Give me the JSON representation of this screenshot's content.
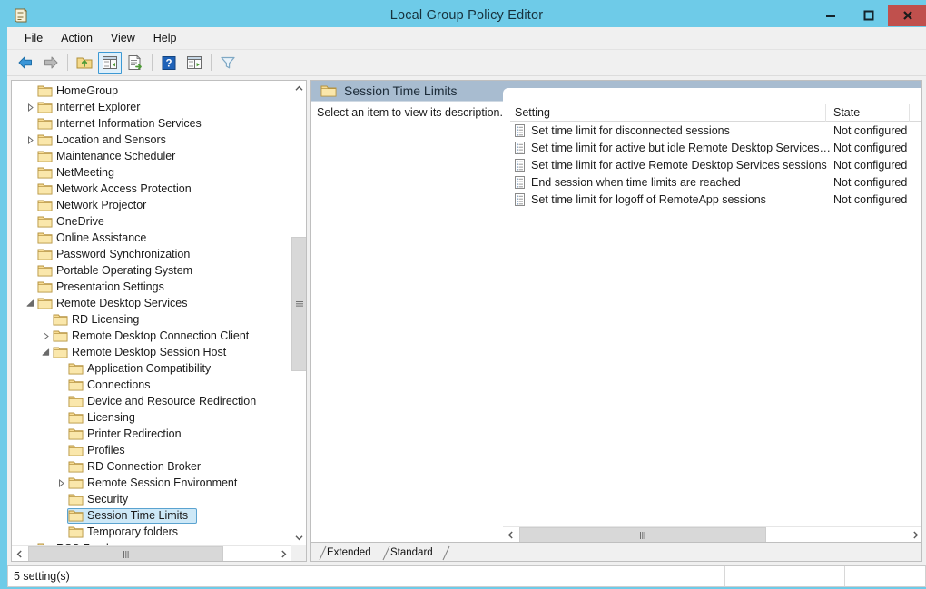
{
  "window": {
    "title": "Local Group Policy Editor",
    "icon": "console-scroll-icon",
    "accent_color": "#6ecbe8",
    "close_button_color": "#c0504d",
    "buttons": {
      "minimize": "minimize",
      "maximize": "maximize",
      "close": "close"
    }
  },
  "menubar": {
    "items": [
      {
        "label": "File"
      },
      {
        "label": "Action"
      },
      {
        "label": "View"
      },
      {
        "label": "Help"
      }
    ]
  },
  "toolbar": {
    "buttons": [
      {
        "name": "back-arrow-icon",
        "tooltip": "Back"
      },
      {
        "name": "forward-arrow-icon",
        "tooltip": "Forward"
      },
      {
        "name": "up-one-level-folder-icon",
        "tooltip": "Up One Level"
      },
      {
        "name": "show-hide-console-tree-icon",
        "tooltip": "Show/Hide Console Tree",
        "selected": true
      },
      {
        "name": "export-list-icon",
        "tooltip": "Export List"
      },
      {
        "name": "help-icon",
        "tooltip": "Help"
      },
      {
        "name": "properties-icon",
        "tooltip": "Properties"
      },
      {
        "name": "filter-icon",
        "tooltip": "Filter"
      }
    ]
  },
  "tree": {
    "nodes": [
      {
        "label": "HomeGroup",
        "indent": 2,
        "twist": "none"
      },
      {
        "label": "Internet Explorer",
        "indent": 2,
        "twist": "collapsed"
      },
      {
        "label": "Internet Information Services",
        "indent": 2,
        "twist": "none"
      },
      {
        "label": "Location and Sensors",
        "indent": 2,
        "twist": "collapsed"
      },
      {
        "label": "Maintenance Scheduler",
        "indent": 2,
        "twist": "none"
      },
      {
        "label": "NetMeeting",
        "indent": 2,
        "twist": "none"
      },
      {
        "label": "Network Access Protection",
        "indent": 2,
        "twist": "none"
      },
      {
        "label": "Network Projector",
        "indent": 2,
        "twist": "none"
      },
      {
        "label": "OneDrive",
        "indent": 2,
        "twist": "none"
      },
      {
        "label": "Online Assistance",
        "indent": 2,
        "twist": "none"
      },
      {
        "label": "Password Synchronization",
        "indent": 2,
        "twist": "none"
      },
      {
        "label": "Portable Operating System",
        "indent": 2,
        "twist": "none"
      },
      {
        "label": "Presentation Settings",
        "indent": 2,
        "twist": "none"
      },
      {
        "label": "Remote Desktop Services",
        "indent": 2,
        "twist": "expanded"
      },
      {
        "label": "RD Licensing",
        "indent": 3,
        "twist": "none"
      },
      {
        "label": "Remote Desktop Connection Client",
        "indent": 3,
        "twist": "collapsed"
      },
      {
        "label": "Remote Desktop Session Host",
        "indent": 3,
        "twist": "expanded"
      },
      {
        "label": "Application Compatibility",
        "indent": 4,
        "twist": "none"
      },
      {
        "label": "Connections",
        "indent": 4,
        "twist": "none"
      },
      {
        "label": "Device and Resource Redirection",
        "indent": 4,
        "twist": "none"
      },
      {
        "label": "Licensing",
        "indent": 4,
        "twist": "none"
      },
      {
        "label": "Printer Redirection",
        "indent": 4,
        "twist": "none"
      },
      {
        "label": "Profiles",
        "indent": 4,
        "twist": "none"
      },
      {
        "label": "RD Connection Broker",
        "indent": 4,
        "twist": "none"
      },
      {
        "label": "Remote Session Environment",
        "indent": 4,
        "twist": "collapsed"
      },
      {
        "label": "Security",
        "indent": 4,
        "twist": "none"
      },
      {
        "label": "Session Time Limits",
        "indent": 4,
        "twist": "none",
        "selected": true
      },
      {
        "label": "Temporary folders",
        "indent": 4,
        "twist": "none"
      },
      {
        "label": "RSS Feeds",
        "indent": 2,
        "twist": "none"
      }
    ],
    "selected_label": "Session Time Limits",
    "selection_background": "#cde8f7",
    "selection_border": "#5ba3d0"
  },
  "right_pane": {
    "header_title": "Session Time Limits",
    "header_icon": "folder-icon",
    "header_band_color": "#a8bcd0",
    "description": "Select an item to view its description.",
    "columns": [
      {
        "label": "Setting"
      },
      {
        "label": "State"
      },
      {
        "label": ""
      }
    ],
    "rows": [
      {
        "icon": "policy-setting-icon",
        "setting": "Set time limit for disconnected sessions",
        "state": "Not configured"
      },
      {
        "icon": "policy-setting-icon",
        "setting": "Set time limit for active but idle Remote Desktop Services se...",
        "state": "Not configured"
      },
      {
        "icon": "policy-setting-icon",
        "setting": "Set time limit for active Remote Desktop Services sessions",
        "state": "Not configured"
      },
      {
        "icon": "policy-setting-icon",
        "setting": "End session when time limits are reached",
        "state": "Not configured"
      },
      {
        "icon": "policy-setting-icon",
        "setting": "Set time limit for logoff of RemoteApp sessions",
        "state": "Not configured"
      }
    ],
    "tabs": [
      {
        "label": "Extended",
        "active": false
      },
      {
        "label": "Standard",
        "active": true
      }
    ]
  },
  "statusbar": {
    "text": "5 setting(s)",
    "cell2": "",
    "cell3": ""
  }
}
